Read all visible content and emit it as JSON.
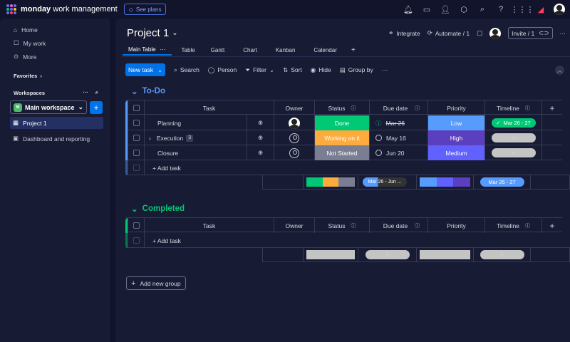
{
  "app": {
    "brand_bold": "monday",
    "brand_rest": " work management",
    "see_plans": "See plans"
  },
  "sidebar": {
    "nav": [
      {
        "label": "Home",
        "icon": "home-icon"
      },
      {
        "label": "My work",
        "icon": "my-work-icon"
      },
      {
        "label": "More",
        "icon": "more-icon"
      }
    ],
    "favorites": "Favorites",
    "workspaces": "Workspaces",
    "workspace_name": "Main workspace",
    "workspace_badge": "M",
    "boards": [
      {
        "label": "Project 1"
      },
      {
        "label": "Dashboard and reporting"
      }
    ]
  },
  "board": {
    "title": "Project 1",
    "integrate": "Integrate",
    "automate": "Automate / 1",
    "invite": "Invite / 1",
    "tabs": [
      "Main Table",
      "Table",
      "Gantt",
      "Chart",
      "Kanban",
      "Calendar"
    ],
    "toolbar": {
      "new_task": "New task",
      "search": "Search",
      "person": "Person",
      "filter": "Filter",
      "sort": "Sort",
      "hide": "Hide",
      "group_by": "Group by"
    },
    "columns": {
      "task": "Task",
      "owner": "Owner",
      "status": "Status",
      "due": "Due date",
      "priority": "Priority",
      "timeline": "Timeline"
    },
    "add_task": "+ Add task",
    "add_group": "Add new group"
  },
  "groups": [
    {
      "name": "To-Do",
      "color": "#579bfc",
      "rows": [
        {
          "task": "Planning",
          "status": "Done",
          "status_color": "#00c875",
          "due": "Mar 26",
          "due_done": true,
          "priority": "Low",
          "priority_color": "#579bfc",
          "timeline": "Mar 26 - 27",
          "timeline_color": "#00c875",
          "subitems": ""
        },
        {
          "task": "Execution",
          "status": "Working on it",
          "status_color": "#fdab3d",
          "due": "May 16",
          "due_done": false,
          "priority": "High",
          "priority_color": "#5b3fbf",
          "timeline": "-",
          "timeline_color": "#c4c4c4",
          "subitems": "3"
        },
        {
          "task": "Closure",
          "status": "Not Started",
          "status_color": "#797e93",
          "due": "Jun 20",
          "due_done": false,
          "priority": "Medium",
          "priority_color": "#6161ff",
          "timeline": "-",
          "timeline_color": "#c4c4c4",
          "subitems": ""
        }
      ],
      "summary": {
        "due": "Mar 26 - Jun ...",
        "timeline": "Mar 26 - 27"
      }
    },
    {
      "name": "Completed",
      "color": "#00c875",
      "rows": [],
      "summary": {
        "due": "-",
        "timeline": "-"
      }
    }
  ]
}
